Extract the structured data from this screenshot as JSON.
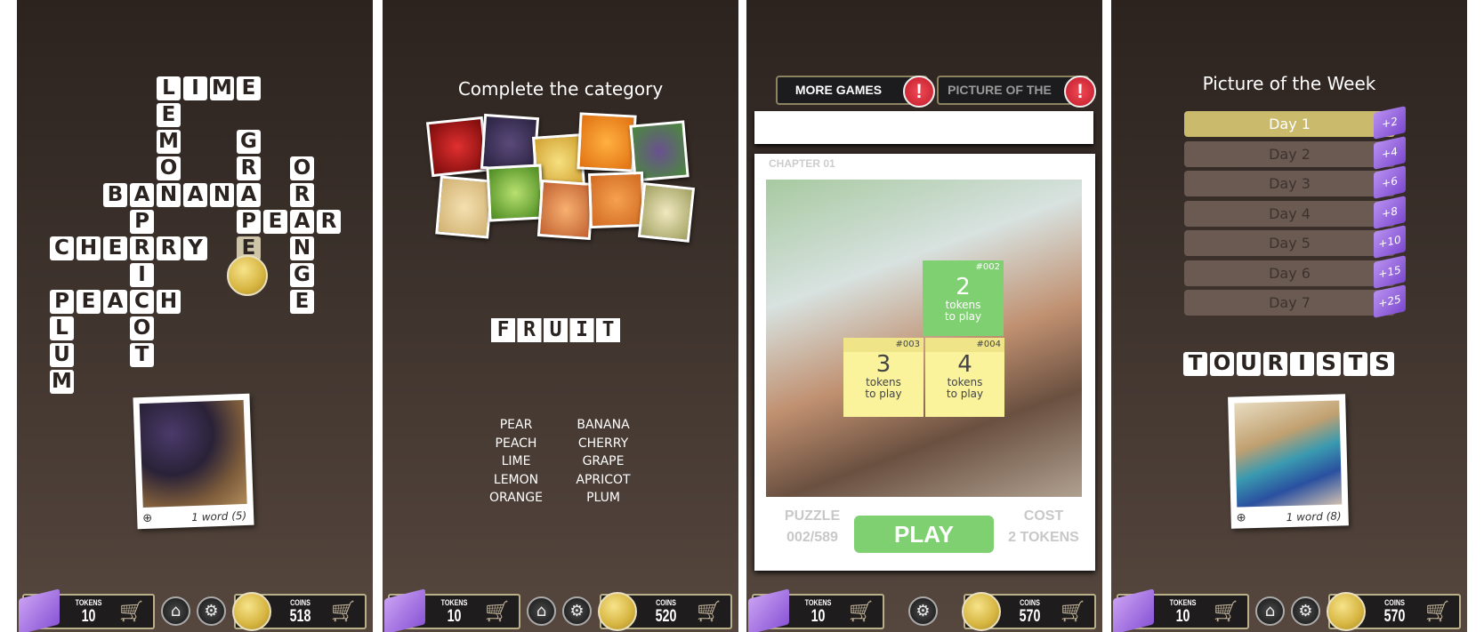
{
  "colors": {
    "background_top": "#2c231f",
    "background_bottom": "#56473e",
    "play_green": "#7fd070",
    "note_yellow": "#faf39c",
    "day_active": "#c9bb6b",
    "token_purple": "#9a64e0"
  },
  "screens": [
    {
      "hud": {
        "tokens_label": "TOKENS",
        "tokens": "10",
        "coins_label": "COINS",
        "coins": "518",
        "home": true
      }
    },
    {
      "hud": {
        "tokens_label": "TOKENS",
        "tokens": "10",
        "coins_label": "COINS",
        "coins": "520",
        "home": true
      }
    },
    {
      "hud": {
        "tokens_label": "TOKENS",
        "tokens": "10",
        "coins_label": "COINS",
        "coins": "570",
        "home": false
      }
    },
    {
      "hud": {
        "tokens_label": "TOKENS",
        "tokens": "10",
        "coins_label": "COINS",
        "coins": "570",
        "home": true
      }
    }
  ],
  "crossword": {
    "words": [
      "LIME",
      "LEMON",
      "GRAPE",
      "ORANGE",
      "BANANA",
      "PEAR",
      "APRICOT",
      "CHERRY",
      "PEACH",
      "PLUM"
    ],
    "photo_caption": "1 word (5)"
  },
  "category": {
    "title": "Complete the category",
    "answer": "FRUIT",
    "word_list_left": [
      "PEAR",
      "PEACH",
      "LIME",
      "LEMON",
      "ORANGE"
    ],
    "word_list_right": [
      "BANANA",
      "CHERRY",
      "GRAPE",
      "APRICOT",
      "PLUM"
    ]
  },
  "chapter": {
    "tabs": [
      {
        "label": "MORE GAMES",
        "alert": "!"
      },
      {
        "label": "PICTURE OF THE WEEK",
        "alert": "!"
      }
    ],
    "chapter_label": "CHAPTER 01",
    "notes": [
      {
        "id": "#002",
        "tokens": "2",
        "text1": "tokens",
        "text2": "to play",
        "color": "#7fd070"
      },
      {
        "id": "#003",
        "tokens": "3",
        "text1": "tokens",
        "text2": "to play",
        "color": "#faf39c"
      },
      {
        "id": "#004",
        "tokens": "4",
        "text1": "tokens",
        "text2": "to play",
        "color": "#faf39c"
      }
    ],
    "puzzle_label": "PUZZLE",
    "puzzle_value": "002/589",
    "play_label": "PLAY",
    "cost_label": "COST",
    "cost_value": "2 TOKENS"
  },
  "week": {
    "title": "Picture of the Week",
    "days": [
      {
        "label": "Day 1",
        "bonus": "+2",
        "active": true
      },
      {
        "label": "Day 2",
        "bonus": "+4",
        "active": false
      },
      {
        "label": "Day 3",
        "bonus": "+6",
        "active": false
      },
      {
        "label": "Day 4",
        "bonus": "+8",
        "active": false
      },
      {
        "label": "Day 5",
        "bonus": "+10",
        "active": false
      },
      {
        "label": "Day 6",
        "bonus": "+15",
        "active": false
      },
      {
        "label": "Day 7",
        "bonus": "+25",
        "active": false
      }
    ],
    "answer": "TOURISTS",
    "photo_caption": "1 word (8)"
  }
}
